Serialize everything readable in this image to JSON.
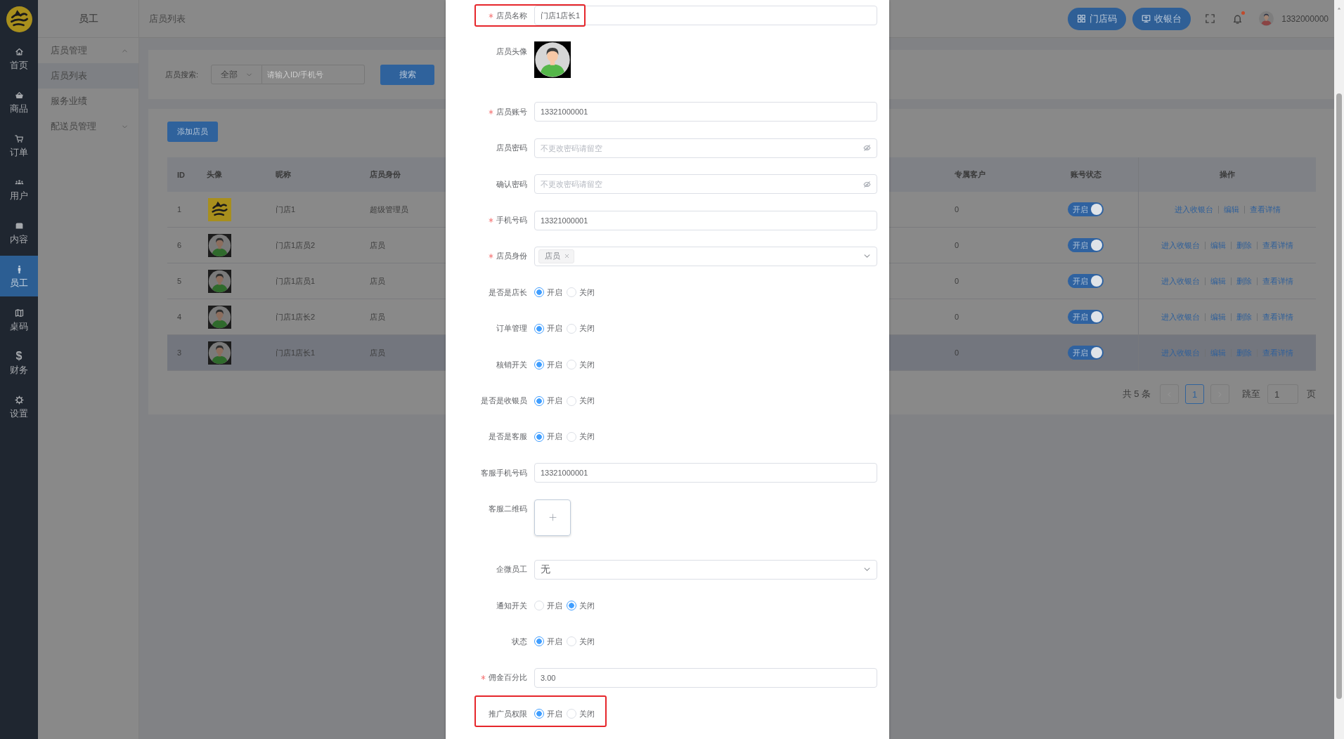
{
  "sidebar": {
    "items": [
      {
        "label": "首页",
        "selected": false
      },
      {
        "label": "商品",
        "selected": false
      },
      {
        "label": "订单",
        "selected": false
      },
      {
        "label": "用户",
        "selected": false
      },
      {
        "label": "内容",
        "selected": false
      },
      {
        "label": "员工",
        "selected": true
      },
      {
        "label": "桌码",
        "selected": false
      },
      {
        "label": "财务",
        "glyph": "$",
        "selected": false
      },
      {
        "label": "设置",
        "selected": false
      }
    ]
  },
  "submenu": {
    "title": "员工",
    "items": [
      {
        "label": "店员管理",
        "expanded": true,
        "children": [
          {
            "label": "店员列表",
            "selected": true
          },
          {
            "label": "服务业绩",
            "selected": false
          }
        ]
      },
      {
        "label": "配送员管理",
        "expanded": false
      }
    ]
  },
  "header": {
    "breadcrumb": "店员列表",
    "buttons": [
      "门店码",
      "收银台"
    ],
    "unread": true,
    "username": "1332000000"
  },
  "search": {
    "label": "店员搜索:",
    "filter": "全部",
    "placeholder": "请输入ID/手机号",
    "button": "搜索"
  },
  "add_button": "添加店员",
  "table": {
    "columns": [
      "ID",
      "头像",
      "昵称",
      "店员身份",
      "专属客户",
      "账号状态",
      "操作"
    ],
    "rows": [
      {
        "id": "1",
        "avatar": {
          "kind": "logo"
        },
        "nickname": "门店1",
        "role": "超级管理员",
        "exclusive_customers": "0",
        "status": {
          "label": "开启",
          "on": true
        },
        "actions": [
          "进入收银台",
          "编辑",
          "查看详情"
        ],
        "hovered": false
      },
      {
        "id": "6",
        "avatar": {
          "kind": "person"
        },
        "nickname": "门店1店员2",
        "role": "店员",
        "exclusive_customers": "0",
        "status": {
          "label": "开启",
          "on": true
        },
        "actions": [
          "进入收银台",
          "编辑",
          "删除",
          "查看详情"
        ],
        "hovered": false
      },
      {
        "id": "5",
        "avatar": {
          "kind": "person"
        },
        "nickname": "门店1店员1",
        "role": "店员",
        "exclusive_customers": "0",
        "status": {
          "label": "开启",
          "on": true
        },
        "actions": [
          "进入收银台",
          "编辑",
          "删除",
          "查看详情"
        ],
        "hovered": false
      },
      {
        "id": "4",
        "avatar": {
          "kind": "person"
        },
        "nickname": "门店1店长2",
        "role": "店员",
        "exclusive_customers": "0",
        "status": {
          "label": "开启",
          "on": true
        },
        "actions": [
          "进入收银台",
          "编辑",
          "删除",
          "查看详情"
        ],
        "hovered": false
      },
      {
        "id": "3",
        "avatar": {
          "kind": "person"
        },
        "nickname": "门店1店长1",
        "role": "店员",
        "exclusive_customers": "0",
        "status": {
          "label": "开启",
          "on": true
        },
        "actions": [
          "进入收银台",
          "编辑",
          "删除",
          "查看详情"
        ],
        "hovered": true
      }
    ]
  },
  "pagination": {
    "total": "共 5 条",
    "prev_disabled": true,
    "pages": [
      {
        "label": "1",
        "selected": true
      }
    ],
    "next_disabled": true,
    "jump_label": "跳至",
    "jump_value": "1",
    "suffix": "页"
  },
  "dialog": {
    "fields": [
      {
        "kind": "text",
        "label": "店员名称",
        "required": true,
        "highlighted": true,
        "value": "门店1店长1"
      },
      {
        "kind": "image",
        "label": "店员头像",
        "required": false,
        "highlighted": false
      },
      {
        "kind": "text",
        "label": "店员账号",
        "required": true,
        "highlighted": false,
        "value": "13321000001"
      },
      {
        "kind": "password",
        "label": "店员密码",
        "required": false,
        "highlighted": false,
        "placeholder": "不更改密码请留空"
      },
      {
        "kind": "password",
        "label": "确认密码",
        "required": false,
        "highlighted": false,
        "placeholder": "不更改密码请留空"
      },
      {
        "kind": "text",
        "label": "手机号码",
        "required": true,
        "highlighted": false,
        "value": "13321000001"
      },
      {
        "kind": "tags",
        "label": "店员身份",
        "required": true,
        "highlighted": false,
        "tags": [
          "店员"
        ]
      },
      {
        "kind": "radio",
        "label": "是否是店长",
        "required": false,
        "highlighted": false,
        "options": [
          {
            "label": "开启",
            "selected": true
          },
          {
            "label": "关闭",
            "selected": false
          }
        ]
      },
      {
        "kind": "radio",
        "label": "订单管理",
        "required": false,
        "highlighted": false,
        "options": [
          {
            "label": "开启",
            "selected": true
          },
          {
            "label": "关闭",
            "selected": false
          }
        ]
      },
      {
        "kind": "radio",
        "label": "核销开关",
        "required": false,
        "highlighted": false,
        "options": [
          {
            "label": "开启",
            "selected": true
          },
          {
            "label": "关闭",
            "selected": false
          }
        ]
      },
      {
        "kind": "radio",
        "label": "是否是收银员",
        "required": false,
        "highlighted": false,
        "options": [
          {
            "label": "开启",
            "selected": true
          },
          {
            "label": "关闭",
            "selected": false
          }
        ]
      },
      {
        "kind": "radio",
        "label": "是否是客服",
        "required": false,
        "highlighted": false,
        "options": [
          {
            "label": "开启",
            "selected": true
          },
          {
            "label": "关闭",
            "selected": false
          }
        ]
      },
      {
        "kind": "text",
        "label": "客服手机号码",
        "required": false,
        "highlighted": false,
        "value": "13321000001"
      },
      {
        "kind": "upload",
        "label": "客服二维码",
        "required": false,
        "highlighted": false
      },
      {
        "kind": "select",
        "label": "企微员工",
        "required": false,
        "highlighted": false,
        "value": "无"
      },
      {
        "kind": "radio",
        "label": "通知开关",
        "required": false,
        "highlighted": false,
        "options": [
          {
            "label": "开启",
            "selected": false
          },
          {
            "label": "关闭",
            "selected": true
          }
        ]
      },
      {
        "kind": "radio",
        "label": "状态",
        "required": false,
        "highlighted": false,
        "options": [
          {
            "label": "开启",
            "selected": true
          },
          {
            "label": "关闭",
            "selected": false
          }
        ]
      },
      {
        "kind": "text",
        "label": "佣金百分比",
        "required": true,
        "highlighted": false,
        "value": "3.00"
      },
      {
        "kind": "radio",
        "label": "推广员权限",
        "required": false,
        "highlighted": true,
        "options": [
          {
            "label": "开启",
            "selected": true
          },
          {
            "label": "关闭",
            "selected": false
          }
        ]
      }
    ]
  }
}
